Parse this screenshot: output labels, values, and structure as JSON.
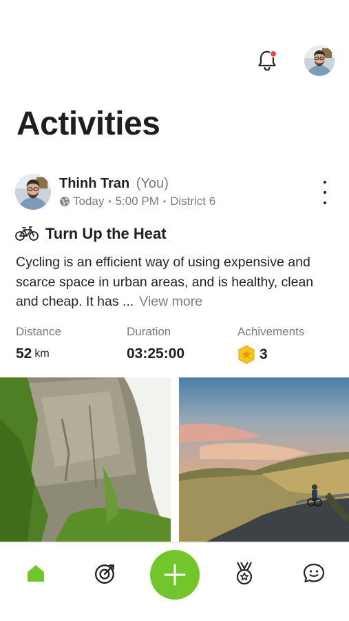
{
  "header": {
    "notification_icon": "bell-icon",
    "has_unread": true,
    "profile_avatar": "user-avatar"
  },
  "page": {
    "title": "Activities"
  },
  "post": {
    "author": "Thinh Tran",
    "you_tag": "(You)",
    "visibility_icon": "globe-icon",
    "date": "Today",
    "time": "5:00 PM",
    "location": "District 6",
    "activity_icon": "bicycle-icon",
    "title": "Turn Up the Heat",
    "body": "Cycling is an efficient way of using expensive and scarce space in urban areas, and is healthy, clean and cheap. It has ...",
    "view_more": "View more",
    "stats": {
      "distance_label": "Distance",
      "distance_value": "52",
      "distance_unit": "km",
      "duration_label": "Duration",
      "duration_value": "03:25:00",
      "achievements_label": "Achivements",
      "achievements_value": "3"
    }
  },
  "tabbar": {
    "items": [
      "home-icon",
      "target-icon",
      "add-icon",
      "medal-icon",
      "chat-icon"
    ],
    "active": "home-icon"
  },
  "colors": {
    "accent": "#73c52c",
    "notification_dot": "#f04040",
    "badge_gold": "#f5c518",
    "text_primary": "#1f1f1f",
    "text_secondary": "#7a7a7a"
  }
}
